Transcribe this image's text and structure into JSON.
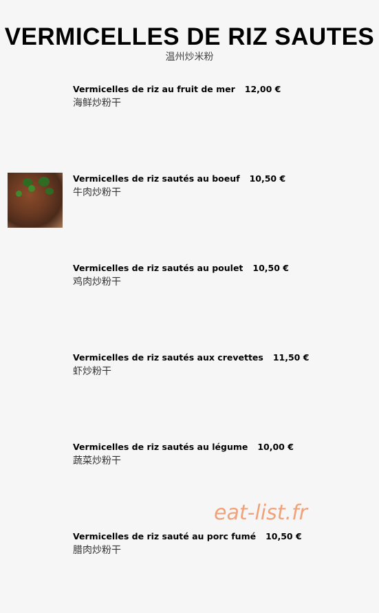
{
  "header": {
    "title": "VERMICELLES DE RIZ SAUTES",
    "subtitle": "温州炒米粉"
  },
  "items": [
    {
      "name": "Vermicelles de riz au fruit de mer",
      "price": "12,00 €",
      "cn": "海鲜炒粉干"
    },
    {
      "name": "Vermicelles de riz sautés au boeuf",
      "price": "10,50 €",
      "cn": "牛肉炒粉干"
    },
    {
      "name": "Vermicelles de riz sautés au poulet",
      "price": "10,50 €",
      "cn": "鸡肉炒粉干"
    },
    {
      "name": "Vermicelles de riz sautés aux crevettes",
      "price": "11,50 €",
      "cn": "虾炒粉干"
    },
    {
      "name": "Vermicelles de riz sautés au légume",
      "price": "10,00 €",
      "cn": "蔬菜炒粉干"
    },
    {
      "name": "Vermicelles de riz sauté au porc fumé",
      "price": "10,50 €",
      "cn": "腊肉炒粉干"
    }
  ],
  "watermark": "eat-list.fr"
}
